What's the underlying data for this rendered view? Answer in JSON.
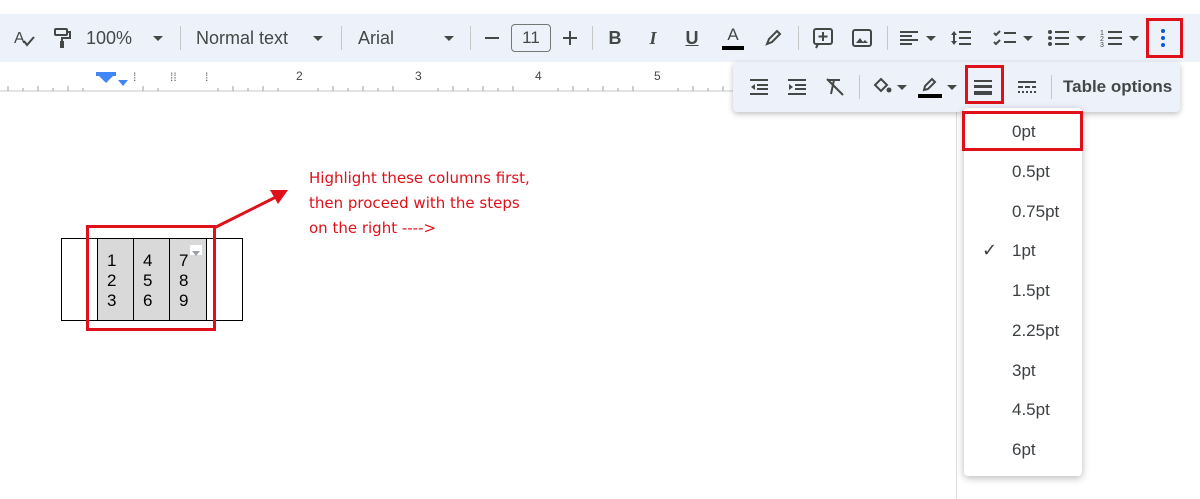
{
  "toolbar": {
    "zoom": "100%",
    "style": "Normal text",
    "font": "Arial",
    "font_size": "11",
    "bold": "B",
    "italic": "I",
    "underline": "U",
    "text_color": "A"
  },
  "ruler": {
    "marks": [
      "2",
      "3",
      "4",
      "5"
    ]
  },
  "table_popup": {
    "options_label": "Table options"
  },
  "border_width_menu": {
    "options": [
      "0pt",
      "0.5pt",
      "0.75pt",
      "1pt",
      "1.5pt",
      "2.25pt",
      "3pt",
      "4.5pt",
      "6pt"
    ],
    "checked": "1pt",
    "check_mark": "✓"
  },
  "document": {
    "table": [
      [
        "1",
        "4",
        "7"
      ],
      [
        "2",
        "5",
        "8"
      ],
      [
        "3",
        "6",
        "9"
      ]
    ],
    "annotation": [
      "Highlight these columns first,",
      "then proceed with the steps",
      "on the right ---->"
    ]
  },
  "colors": {
    "annotation_red": "#e0101a",
    "toolbar_bg": "#edf2fa",
    "selected_cell_bg": "#d9d9d9"
  }
}
